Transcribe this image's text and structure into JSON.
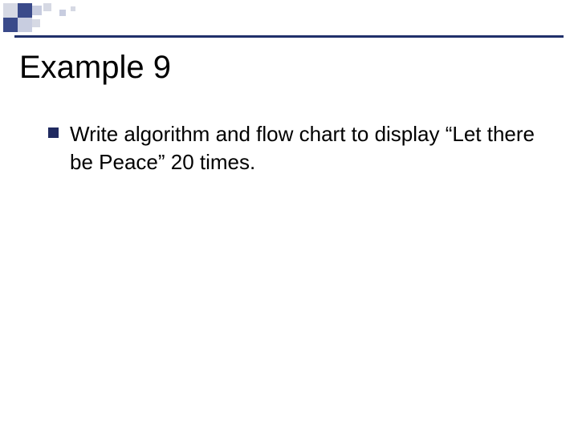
{
  "slide": {
    "title": "Example 9",
    "bullets": [
      {
        "text": "Write algorithm and flow chart to display “Let there be Peace” 20 times."
      }
    ]
  }
}
